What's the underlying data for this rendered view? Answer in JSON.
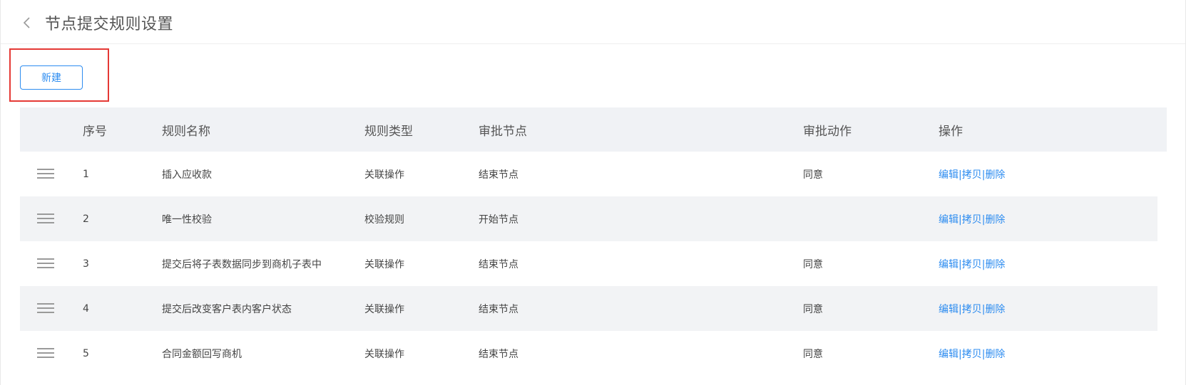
{
  "header": {
    "title": "节点提交规则设置",
    "back_icon": "chevron-left-icon"
  },
  "toolbar": {
    "new_label": "新建",
    "highlight_color": "#e53935"
  },
  "colors": {
    "accent": "#2d8cf0",
    "header_bg": "#f0f2f5",
    "stripe_bg": "#f2f3f5"
  },
  "table": {
    "columns": [
      "",
      "序号",
      "规则名称",
      "规则类型",
      "审批节点",
      "审批动作",
      "操作"
    ],
    "rows": [
      {
        "index": "1",
        "name": "插入应收款",
        "type": "关联操作",
        "node": "结束节点",
        "action": "同意"
      },
      {
        "index": "2",
        "name": "唯一性校验",
        "type": "校验规则",
        "node": "开始节点",
        "action": ""
      },
      {
        "index": "3",
        "name": "提交后将子表数据同步到商机子表中",
        "type": "关联操作",
        "node": "结束节点",
        "action": "同意"
      },
      {
        "index": "4",
        "name": "提交后改变客户表内客户状态",
        "type": "关联操作",
        "node": "结束节点",
        "action": "同意"
      },
      {
        "index": "5",
        "name": "合同金额回写商机",
        "type": "关联操作",
        "node": "结束节点",
        "action": "同意"
      }
    ],
    "ops": {
      "edit": "编辑",
      "copy": "拷贝",
      "delete": "删除",
      "separator": "|"
    },
    "drag_icon": "drag-handle-icon"
  }
}
